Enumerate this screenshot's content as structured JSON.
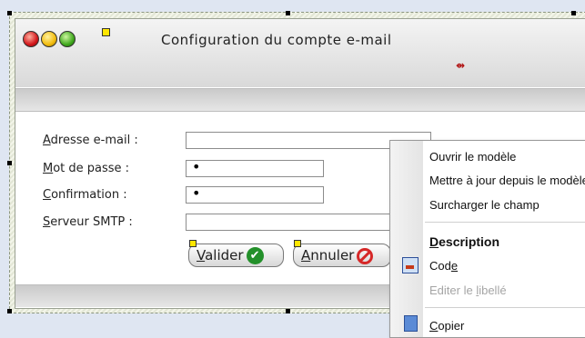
{
  "window": {
    "title": "Configuration du compte e-mail",
    "arrow_glyph": "⇴",
    "controls": [
      "close-icon",
      "minimize-icon",
      "maximize-icon"
    ]
  },
  "form": {
    "rows": [
      {
        "label_first": "A",
        "label_rest": "dresse e-mail :",
        "value": "",
        "masked": false
      },
      {
        "label_first": "M",
        "label_rest": "ot de passe :",
        "value": "•",
        "masked": true
      },
      {
        "label_first": "C",
        "label_rest": "onfirmation :",
        "value": "•",
        "masked": true
      },
      {
        "label_first": "S",
        "label_rest": "erveur SMTP :",
        "value": "",
        "masked": false
      }
    ],
    "validate_first": "V",
    "validate_rest": "alider",
    "cancel_first": "A",
    "cancel_rest": "nnuler"
  },
  "context_menu": {
    "items": [
      {
        "label": "Ouvrir le modèle",
        "style": "normal"
      },
      {
        "label": "Mettre à jour depuis le modèle",
        "style": "normal"
      },
      {
        "label": "Surcharger le champ",
        "style": "normal"
      },
      {
        "label_first": "D",
        "label_rest": "escription",
        "style": "bold"
      },
      {
        "label_start": "Cod",
        "label_u": "e",
        "style": "normal",
        "icon": "code-icon"
      },
      {
        "label_start": "Editer le ",
        "label_u": "l",
        "label_end": "ibellé",
        "style": "disabled"
      },
      {
        "label_first": "C",
        "label_rest": "opier",
        "style": "normal",
        "icon": "copy-icon"
      }
    ]
  },
  "colors": {
    "titlebar": "#e6e6e6",
    "validate_icon": "#23902a",
    "cancel_icon": "#d62828"
  }
}
